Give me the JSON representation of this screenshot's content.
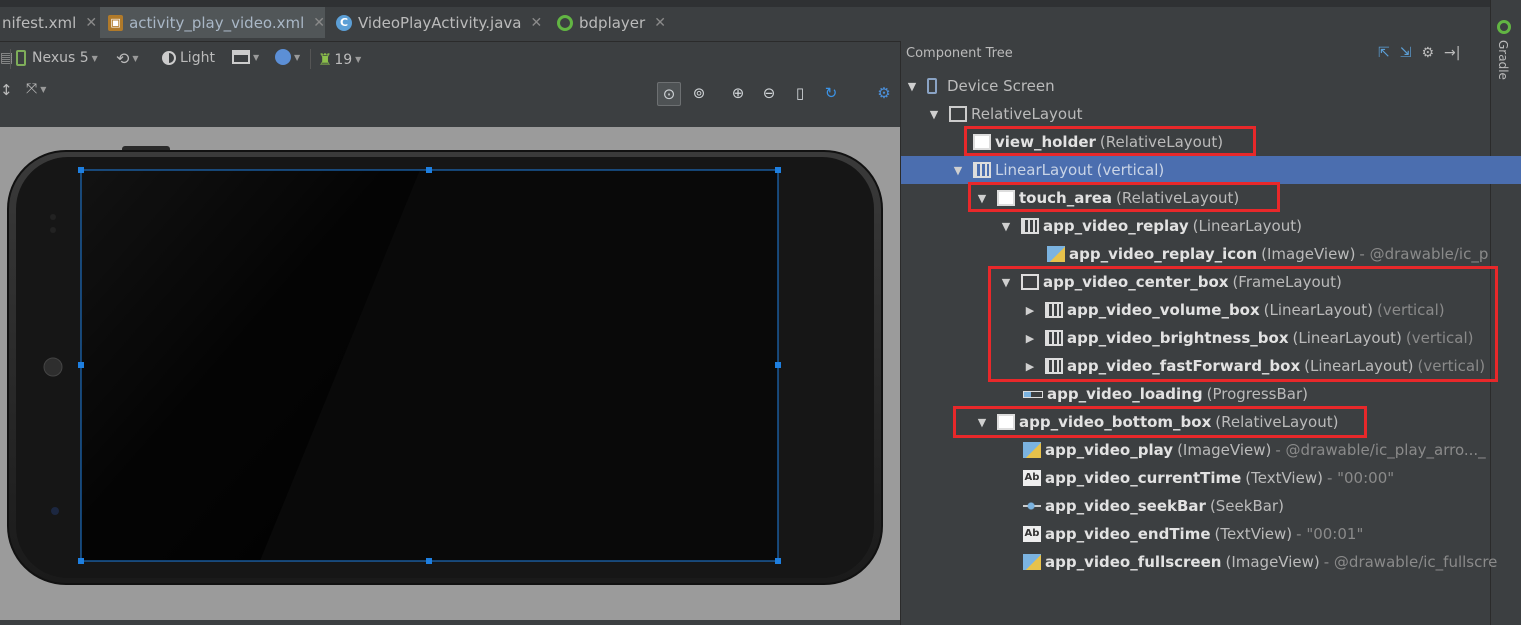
{
  "tabs": [
    {
      "label": "nifest.xml",
      "icon": "xml-file-icon"
    },
    {
      "label": "activity_play_video.xml",
      "icon": "layout-file-icon",
      "active": true
    },
    {
      "label": "VideoPlayActivity.java",
      "icon": "java-class-icon"
    },
    {
      "label": "bdplayer",
      "icon": "module-icon"
    }
  ],
  "toolbar": {
    "device": "Nexus 5",
    "theme": "Light",
    "api": "19"
  },
  "component_tree": {
    "title": "Component Tree",
    "nodes": [
      {
        "name": "Device Screen",
        "type": "",
        "extra": "",
        "expanded": true
      },
      {
        "name": "RelativeLayout",
        "type": "",
        "extra": "",
        "expanded": true
      },
      {
        "name": "view_holder",
        "type": "(RelativeLayout)",
        "extra": ""
      },
      {
        "name": "LinearLayout",
        "type": "(vertical)",
        "extra": "",
        "expanded": true
      },
      {
        "name": "touch_area",
        "type": "(RelativeLayout)",
        "extra": "",
        "expanded": true
      },
      {
        "name": "app_video_replay",
        "type": "(LinearLayout)",
        "extra": "",
        "expanded": true
      },
      {
        "name": "app_video_replay_icon",
        "type": "(ImageView)",
        "extra": "- @drawable/ic_p"
      },
      {
        "name": "app_video_center_box",
        "type": "(FrameLayout)",
        "extra": "",
        "expanded": true
      },
      {
        "name": "app_video_volume_box",
        "type": "(LinearLayout)",
        "extra": "(vertical)"
      },
      {
        "name": "app_video_brightness_box",
        "type": "(LinearLayout)",
        "extra": "(vertical)"
      },
      {
        "name": "app_video_fastForward_box",
        "type": "(LinearLayout)",
        "extra": "(vertical)"
      },
      {
        "name": "app_video_loading",
        "type": "(ProgressBar)",
        "extra": ""
      },
      {
        "name": "app_video_bottom_box",
        "type": "(RelativeLayout)",
        "extra": "",
        "expanded": true
      },
      {
        "name": "app_video_play",
        "type": "(ImageView)",
        "extra": "- @drawable/ic_play_arro..._"
      },
      {
        "name": "app_video_currentTime",
        "type": "(TextView)",
        "extra": "- \"00:00\""
      },
      {
        "name": "app_video_seekBar",
        "type": "(SeekBar)",
        "extra": ""
      },
      {
        "name": "app_video_endTime",
        "type": "(TextView)",
        "extra": "- \"00:01\""
      },
      {
        "name": "app_video_fullscreen",
        "type": "(ImageView)",
        "extra": "- @drawable/ic_fullscre"
      }
    ]
  },
  "side_tool": {
    "label": "Gradle"
  },
  "colors": {
    "selection": "#4b6eaf",
    "highlight_box": "#e8282a",
    "layout_bounds": "#1e7fe0"
  }
}
